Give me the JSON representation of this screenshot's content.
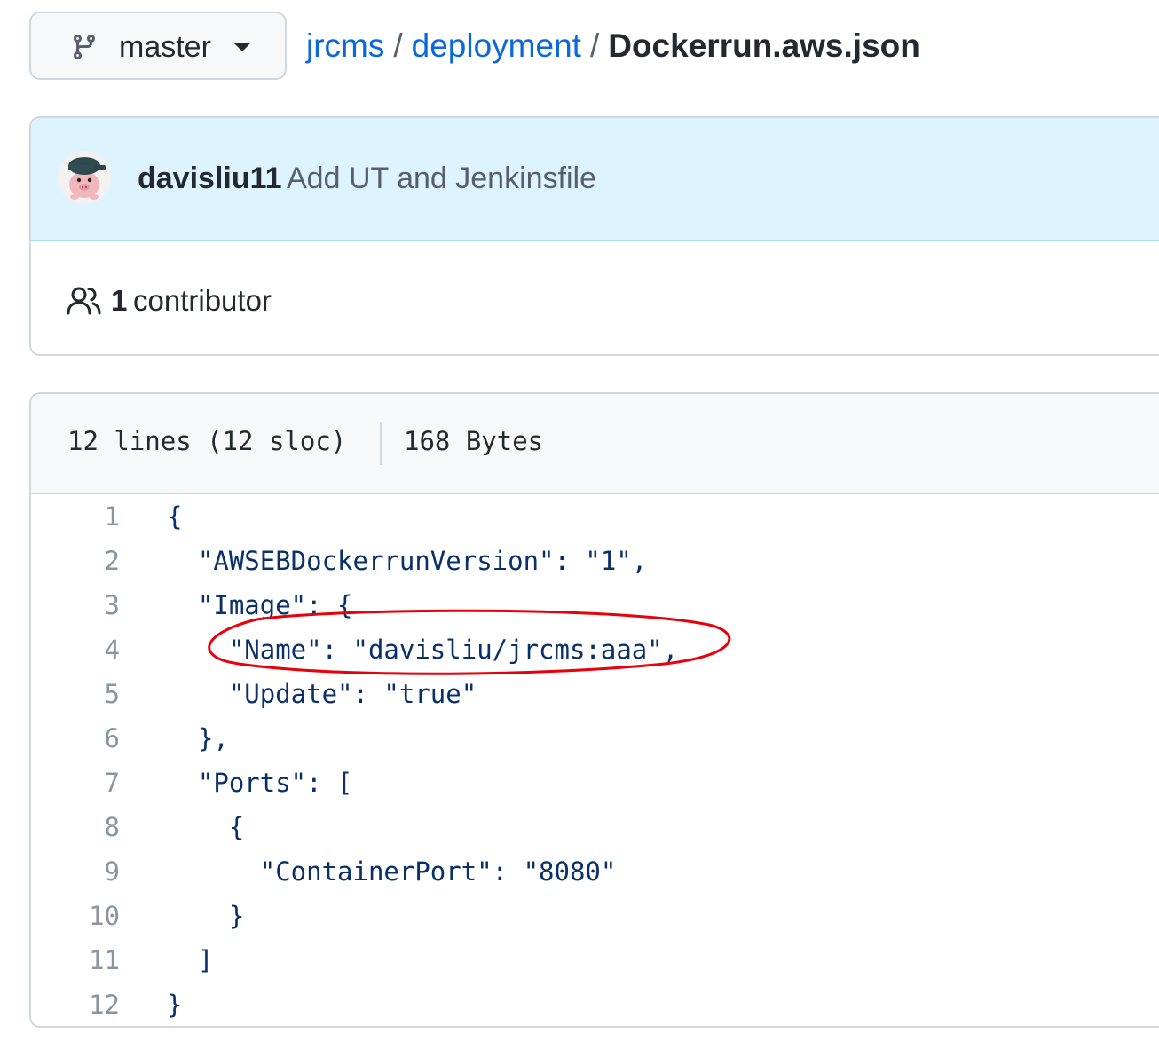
{
  "branch": {
    "name": "master",
    "icon": "git-branch-icon"
  },
  "breadcrumb": {
    "repo": "jrcms",
    "folder": "deployment",
    "file": "Dockerrun.aws.json",
    "separator": "/"
  },
  "commit": {
    "author": "davisliu11",
    "message": "Add UT and Jenkinsfile"
  },
  "contributors": {
    "count": "1",
    "label": "contributor",
    "icon": "people-icon"
  },
  "file_info": {
    "lines": "12 lines (12 sloc)",
    "size": "168 Bytes"
  },
  "code": [
    {
      "n": "1",
      "text": "{"
    },
    {
      "n": "2",
      "text": "  \"AWSEBDockerrunVersion\": \"1\","
    },
    {
      "n": "3",
      "text": "  \"Image\": {"
    },
    {
      "n": "4",
      "text": "    \"Name\": \"davisliu/jrcms:aaa\","
    },
    {
      "n": "5",
      "text": "    \"Update\": \"true\""
    },
    {
      "n": "6",
      "text": "  },"
    },
    {
      "n": "7",
      "text": "  \"Ports\": ["
    },
    {
      "n": "8",
      "text": "    {"
    },
    {
      "n": "9",
      "text": "      \"ContainerPort\": \"8080\""
    },
    {
      "n": "10",
      "text": "    }"
    },
    {
      "n": "11",
      "text": "  ]"
    },
    {
      "n": "12",
      "text": "}"
    }
  ],
  "colors": {
    "link": "#0969da",
    "annotation": "#e8000b",
    "commit_bg": "#ddf4ff"
  }
}
